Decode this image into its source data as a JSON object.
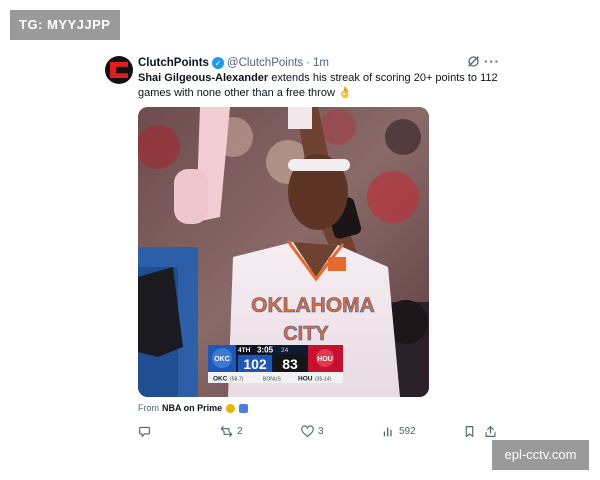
{
  "watermark_top": "TG: MYYJJPP",
  "watermark_bottom": "epl-cctv.com",
  "tweet": {
    "author_name": "ClutchPoints",
    "handle": "@ClutchPoints",
    "separator": "·",
    "time": "1m",
    "text_bold": "Shai Gilgeous-Alexander",
    "text_rest": " extends his streak of scoring 20+ points to 112 games with none other than a free throw 👌",
    "source_prefix": "From",
    "source_name": "NBA on Prime",
    "media": {
      "jersey_top": "OKLAHOMA",
      "jersey_bottom": "CITY",
      "scorebug": {
        "home_abbr": "OKC",
        "home_record": "(58-7)",
        "home_score": "102",
        "quarter": "4TH",
        "clock": "3:05",
        "shot_clock": "24",
        "bonus": "BONUS",
        "away_abbr": "HOU",
        "away_record": "(35-14)",
        "away_score": "83"
      }
    },
    "actions": {
      "reply_count": "",
      "retweet_count": "2",
      "like_count": "3",
      "views_count": "592"
    }
  },
  "icons": [
    "grok-icon",
    "more-icon",
    "reply-icon",
    "retweet-icon",
    "like-icon",
    "views-icon",
    "bookmark-icon",
    "share-icon"
  ]
}
